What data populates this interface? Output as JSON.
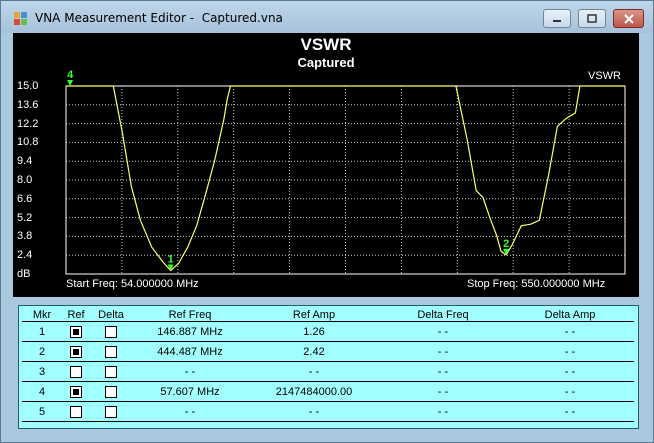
{
  "window": {
    "title": "VNA Measurement Editor -  Captured.vna"
  },
  "chart_data": {
    "type": "line",
    "title": "VSWR",
    "subtitle": "Captured",
    "series": [
      {
        "name": "VSWR",
        "color": "#ffff66",
        "x": [
          54,
          96,
          104,
          112,
          120,
          130,
          140,
          146.9,
          154,
          162,
          170,
          178,
          186,
          194,
          197,
          200,
          350,
          400,
          410,
          418,
          424,
          430,
          436,
          440,
          444.5,
          450,
          458,
          466,
          474,
          482,
          490,
          498,
          506,
          510,
          550
        ],
        "y": [
          15,
          15,
          11.5,
          7.5,
          5.0,
          3.0,
          1.9,
          1.26,
          1.8,
          3.0,
          4.6,
          7.0,
          9.5,
          12.5,
          14,
          15,
          15,
          15,
          11,
          7.2,
          6.7,
          5.2,
          3.9,
          2.7,
          2.42,
          3.2,
          4.6,
          4.7,
          5.0,
          8.3,
          12.0,
          12.6,
          13.0,
          15,
          15
        ]
      }
    ],
    "ylim": [
      1.0,
      15.0
    ],
    "xlim": [
      54,
      550
    ],
    "yticks": [
      "15.0",
      "13.6",
      "12.2",
      "10.8",
      "9.4",
      "8.0",
      "6.6",
      "5.2",
      "3.8",
      "2.4",
      "dB"
    ],
    "grid": true,
    "start_freq_label": "Start Freq: 54.000000 MHz",
    "stop_freq_label": "Stop Freq: 550.000000 MHz",
    "markers": [
      {
        "label": "1",
        "x": 146.887,
        "y": 1.26
      },
      {
        "label": "2",
        "x": 444.487,
        "y": 2.42
      },
      {
        "label": "4",
        "x": 57.607,
        "y": 15.0
      }
    ]
  },
  "table": {
    "headers": [
      "Mkr",
      "Ref",
      "Delta",
      "Ref Freq",
      "Ref Amp",
      "Delta Freq",
      "Delta Amp"
    ],
    "rows": [
      {
        "mkr": "1",
        "ref": true,
        "delta": false,
        "ref_freq": "146.887 MHz",
        "ref_amp": "1.26",
        "delta_freq": "- -",
        "delta_amp": "- -"
      },
      {
        "mkr": "2",
        "ref": true,
        "delta": false,
        "ref_freq": "444.487 MHz",
        "ref_amp": "2.42",
        "delta_freq": "- -",
        "delta_amp": "- -"
      },
      {
        "mkr": "3",
        "ref": false,
        "delta": false,
        "ref_freq": "- -",
        "ref_amp": "- -",
        "delta_freq": "- -",
        "delta_amp": "- -"
      },
      {
        "mkr": "4",
        "ref": true,
        "delta": false,
        "ref_freq": "57.607 MHz",
        "ref_amp": "2147484000.00",
        "delta_freq": "- -",
        "delta_amp": "- -"
      },
      {
        "mkr": "5",
        "ref": false,
        "delta": false,
        "ref_freq": "- -",
        "ref_amp": "- -",
        "delta_freq": "- -",
        "delta_amp": "- -"
      }
    ]
  }
}
